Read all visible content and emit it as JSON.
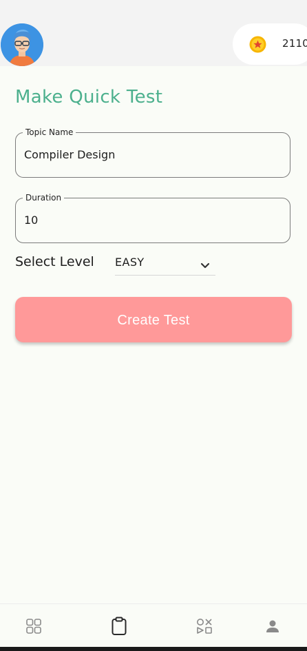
{
  "header": {
    "coins": "2110",
    "avatar_icon": "user-avatar-icon",
    "coin_icon": "star-coin-icon"
  },
  "main": {
    "title": "Make Quick Test",
    "topic": {
      "label": "Topic Name",
      "value": "Compiler Design"
    },
    "duration": {
      "label": "Duration",
      "value": "10"
    },
    "level": {
      "label": "Select Level",
      "value": "EASY"
    },
    "create_button": "Create Test"
  },
  "nav": {
    "items": [
      {
        "icon": "grid-icon"
      },
      {
        "icon": "clipboard-icon"
      },
      {
        "icon": "games-icon"
      },
      {
        "icon": "profile-icon"
      }
    ]
  },
  "colors": {
    "accent": "#4cb08d",
    "button": "#ff9999",
    "background": "#fafcf7",
    "header": "#f3f3f3"
  }
}
